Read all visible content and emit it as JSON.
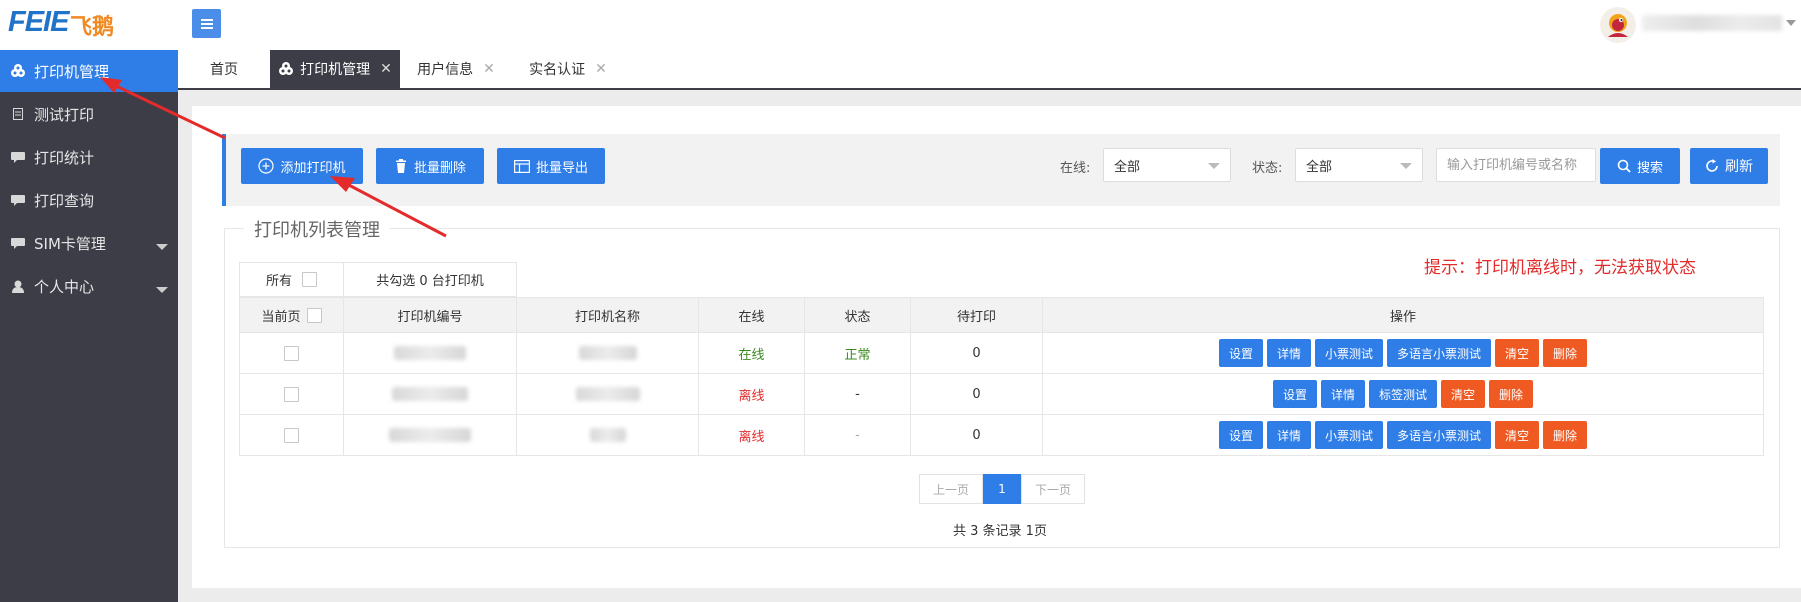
{
  "app": {
    "logo_en": "FEIE",
    "logo_cn": "飞鹅",
    "accent": "#2f7de6",
    "danger": "#ef5a23"
  },
  "sidebar": {
    "items": [
      {
        "label": "打印机管理",
        "icon": "cloud-icon"
      },
      {
        "label": "测试打印",
        "icon": "document-icon"
      },
      {
        "label": "打印统计",
        "icon": "chat-icon"
      },
      {
        "label": "打印查询",
        "icon": "chat-icon"
      },
      {
        "label": "SIM卡管理",
        "icon": "chat-icon"
      },
      {
        "label": "个人中心",
        "icon": "user-icon"
      }
    ]
  },
  "tabs": [
    {
      "label": "首页"
    },
    {
      "label": "打印机管理"
    },
    {
      "label": "用户信息"
    },
    {
      "label": "实名认证"
    }
  ],
  "toolbar": {
    "add_label": "添加打印机",
    "batch_delete_label": "批量删除",
    "batch_export_label": "批量导出",
    "online_label": "在线:",
    "online_value": "全部",
    "status_label": "状态:",
    "status_value": "全部",
    "search_placeholder": "输入打印机编号或名称",
    "search_label": "搜索",
    "refresh_label": "刷新"
  },
  "list": {
    "legend": "打印机列表管理",
    "hint": "提示：打印机离线时，无法获取状态",
    "select_all_label": "所有",
    "selected_count_text": "共勾选 0 台打印机",
    "current_page_label": "当前页",
    "columns": [
      "打印机编号",
      "打印机名称",
      "在线",
      "状态",
      "待打印",
      "操作"
    ],
    "rows": [
      {
        "online": "在线",
        "status": "正常",
        "pending": "0",
        "actions": [
          "设置",
          "详情",
          "小票测试",
          "多语言小票测试",
          "清空",
          "删除"
        ]
      },
      {
        "online": "离线",
        "status": "-",
        "pending": "0",
        "actions": [
          "设置",
          "详情",
          "标签测试",
          "清空",
          "删除"
        ]
      },
      {
        "online": "离线",
        "status": "-",
        "pending": "0",
        "actions": [
          "设置",
          "详情",
          "小票测试",
          "多语言小票测试",
          "清空",
          "删除"
        ]
      }
    ]
  },
  "pagination": {
    "prev_label": "上一页",
    "current_page": "1",
    "next_label": "下一页",
    "summary": "共 3 条记录 1页"
  }
}
